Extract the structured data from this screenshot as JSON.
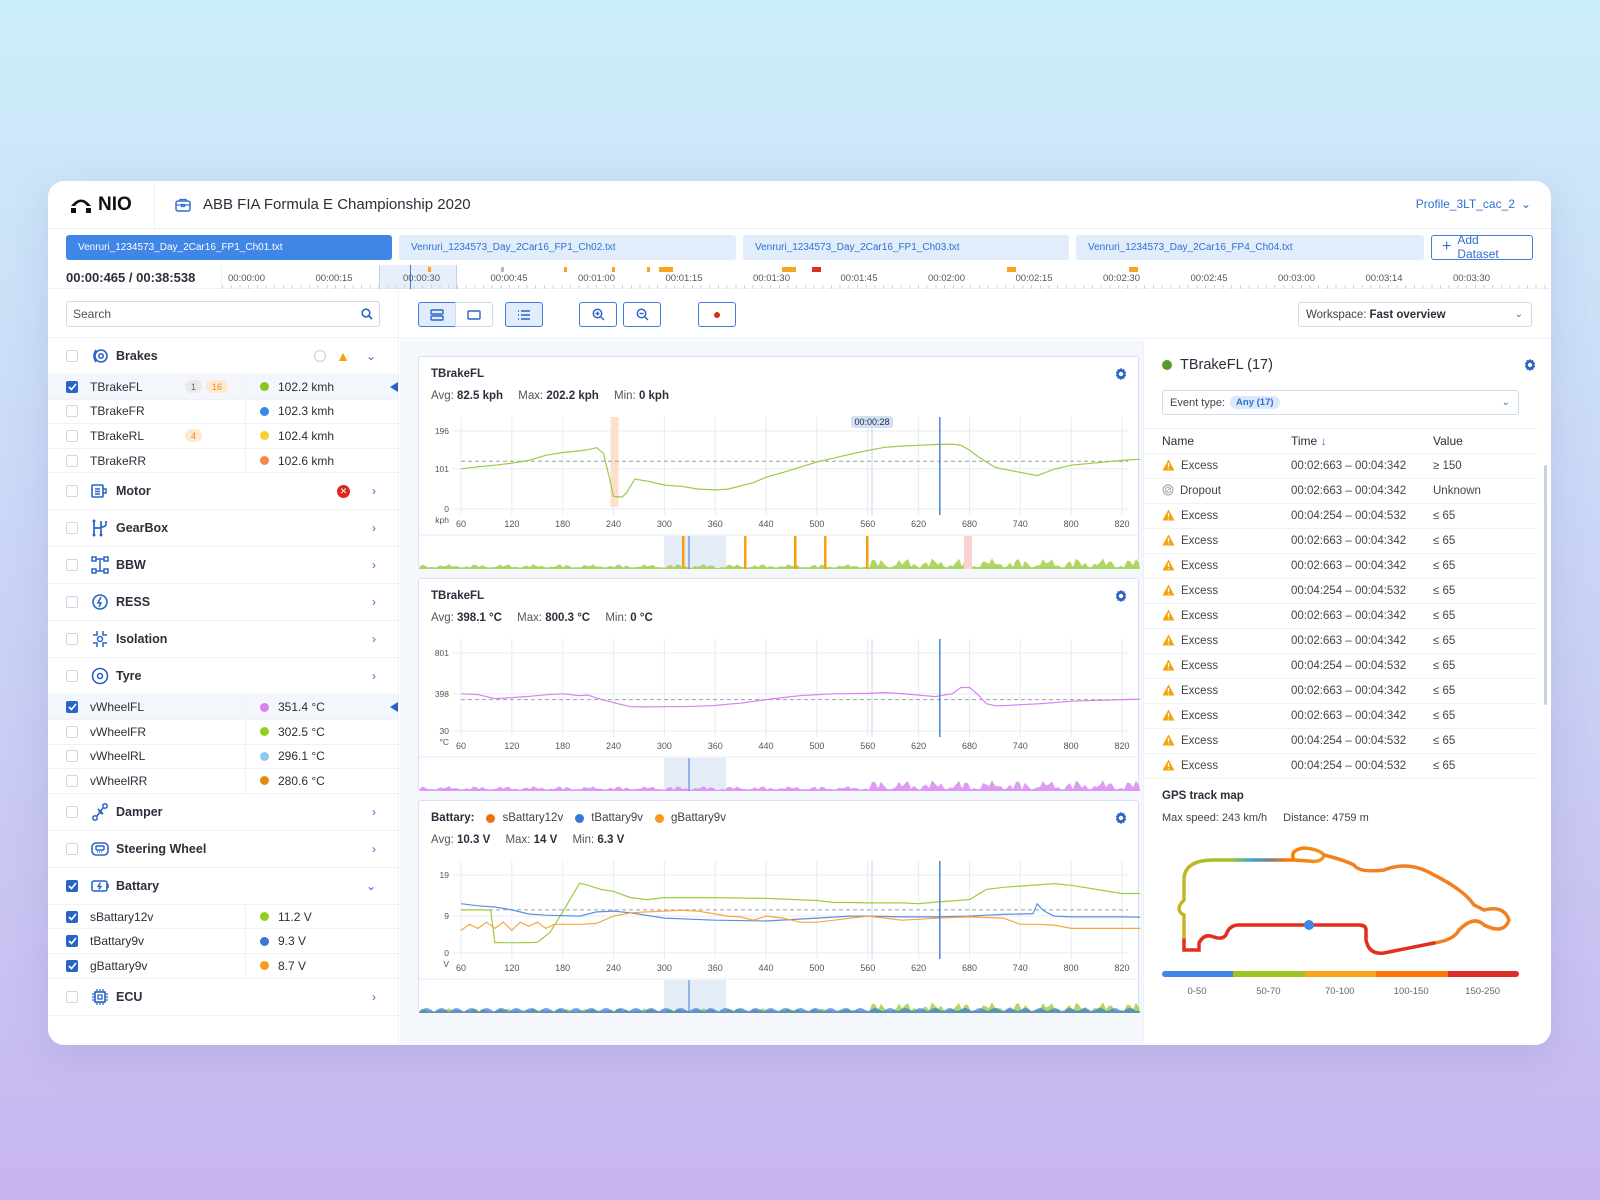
{
  "brand": {
    "name": "NIO"
  },
  "project": {
    "title": "ABB FIA Formula E Championship 2020"
  },
  "profile": {
    "name": "Profile_3LT_cac_2"
  },
  "datasets": {
    "tabs": [
      {
        "label": "Venruri_1234573_Day_2Car16_FP1_Ch01.txt",
        "active": true
      },
      {
        "label": "Venruri_1234573_Day_2Car16_FP1_Ch02.txt",
        "active": false
      },
      {
        "label": "Venruri_1234573_Day_2Car16_FP1_Ch03.txt",
        "active": false
      },
      {
        "label": "Venruri_1234573_Day_2Car16_FP4_Ch04.txt",
        "active": false
      }
    ],
    "add_label": "Add Dataset"
  },
  "timeline": {
    "current": "00:00:465 / 00:38:538",
    "labels": [
      "00:00:00",
      "00:00:15",
      "00:00:30",
      "00:00:45",
      "00:01:00",
      "00:01:15",
      "00:01:30",
      "00:01:45",
      "00:02:00",
      "00:02:15",
      "00:02:30",
      "00:02:45",
      "00:03:00",
      "00:03:14",
      "00:03:30"
    ],
    "markers_color": {
      "warning": "#f5a623",
      "error": "#d93025",
      "neutral": "#b8b8b8"
    }
  },
  "search": {
    "placeholder": "Search"
  },
  "workspace": {
    "label": "Workspace:",
    "value": "Fast overview"
  },
  "tree": {
    "brakes": {
      "name": "Brakes",
      "channels": [
        {
          "name": "TBrakeFL",
          "checked": true,
          "badges": [
            "1",
            "16"
          ],
          "value": "102.2 kmh",
          "color": "#8fc31f"
        },
        {
          "name": "TBrakeFR",
          "checked": false,
          "badges": [],
          "value": "102.3 kmh",
          "color": "#3a86e8"
        },
        {
          "name": "TBrakeRL",
          "checked": false,
          "badges": [
            "4"
          ],
          "value": "102.4 kmh",
          "color": "#f7cf2f"
        },
        {
          "name": "TBrakeRR",
          "checked": false,
          "badges": [],
          "value": "102.6 kmh",
          "color": "#f5894a"
        }
      ]
    },
    "motor": {
      "name": "Motor"
    },
    "gearbox": {
      "name": "GearBox"
    },
    "bbw": {
      "name": "BBW"
    },
    "ress": {
      "name": "RESS"
    },
    "isolation": {
      "name": "Isolation"
    },
    "tyre": {
      "name": "Tyre",
      "channels": [
        {
          "name": "vWheelFL",
          "checked": true,
          "value": "351.4 °C",
          "color": "#d783ef"
        },
        {
          "name": "vWheelFR",
          "checked": false,
          "value": "302.5 °C",
          "color": "#8fd11f"
        },
        {
          "name": "vWheelRL",
          "checked": false,
          "value": "296.1 °C",
          "color": "#8ccaf5"
        },
        {
          "name": "vWheelRR",
          "checked": false,
          "value": "280.6 °C",
          "color": "#e8890f"
        }
      ]
    },
    "damper": {
      "name": "Damper"
    },
    "steering": {
      "name": "Steering Wheel"
    },
    "battery": {
      "name": "Battary",
      "channels": [
        {
          "name": "sBattary12v",
          "checked": true,
          "value": "11.2 V",
          "color": "#8fd11f"
        },
        {
          "name": "tBattary9v",
          "checked": true,
          "value": "9.3 V",
          "color": "#3a76d8"
        },
        {
          "name": "gBattary9v",
          "checked": true,
          "value": "8.7 V",
          "color": "#f89a1c"
        }
      ]
    },
    "ecu": {
      "name": "ECU"
    }
  },
  "charts": [
    {
      "title": "TBrakeFL",
      "stats": {
        "avg_label": "Avg:",
        "avg": "82.5 kph",
        "max_label": "Max:",
        "max": "202.2 kph",
        "min_label": "Min:",
        "min": "0 kph"
      },
      "unit": "kph",
      "y_ticks": [
        "196",
        "101",
        "0"
      ],
      "cursor_label": "00:00:28"
    },
    {
      "title": "TBrakeFL",
      "stats": {
        "avg_label": "Avg:",
        "avg": "398.1 °C",
        "max_label": "Max:",
        "max": "800.3  °C",
        "min_label": "Min:",
        "min": "0 °C"
      },
      "unit": "°C",
      "y_ticks": [
        "801",
        "398",
        "30"
      ]
    },
    {
      "title": "Battary:",
      "legend": [
        "sBattary12v",
        "tBattary9v",
        "gBattary9v"
      ],
      "stats": {
        "avg_label": "Avg:",
        "avg": "10.3 V",
        "max_label": "Max:",
        "max": "14 V",
        "min_label": "Min:",
        "min": "6.3 V"
      },
      "unit": "V",
      "y_ticks": [
        "19",
        "9",
        "0"
      ]
    }
  ],
  "chart_data": [
    {
      "type": "line",
      "title": "TBrakeFL",
      "ylabel": "kph",
      "x_ticks": [
        60,
        120,
        180,
        240,
        300,
        360,
        440,
        500,
        560,
        620,
        680,
        740,
        800,
        820
      ],
      "ylim": [
        0,
        196
      ],
      "avg_line": 120,
      "series": [
        {
          "name": "TBrakeFL",
          "color": "#9acb4a",
          "x": [
            60,
            80,
            100,
            120,
            140,
            160,
            180,
            200,
            210,
            220,
            228,
            235,
            240,
            250,
            255,
            265,
            280,
            300,
            320,
            340,
            360,
            380,
            400,
            420,
            440,
            460,
            480,
            500,
            520,
            540,
            560,
            580,
            600,
            620,
            640,
            660,
            670,
            680,
            690,
            700,
            710,
            720,
            740,
            760,
            780,
            800,
            820,
            840,
            850,
            860,
            870,
            880
          ],
          "y": [
            101,
            106,
            110,
            115,
            122,
            135,
            142,
            146,
            149,
            154,
            140,
            80,
            32,
            30,
            40,
            75,
            70,
            60,
            57,
            50,
            48,
            50,
            58,
            66,
            80,
            92,
            105,
            118,
            128,
            138,
            147,
            155,
            158,
            160,
            162,
            163,
            160,
            148,
            132,
            118,
            105,
            100,
            92,
            84,
            100,
            110,
            122,
            130,
            110,
            104,
            100,
            96
          ]
        }
      ]
    },
    {
      "type": "line",
      "title": "TBrakeFL",
      "ylabel": "°C",
      "x_ticks": [
        60,
        120,
        180,
        240,
        300,
        360,
        440,
        500,
        560,
        620,
        680,
        740,
        800,
        820
      ],
      "ylim": [
        30,
        801
      ],
      "avg_line": 340,
      "series": [
        {
          "name": "vWheelFL",
          "color": "#d783ef",
          "x": [
            60,
            80,
            100,
            120,
            140,
            160,
            180,
            200,
            210,
            220,
            240,
            260,
            280,
            300,
            320,
            340,
            360,
            380,
            400,
            440,
            480,
            520,
            560,
            580,
            600,
            620,
            640,
            660,
            670,
            680,
            690,
            700,
            710,
            720,
            740,
            760,
            780,
            800,
            820,
            840,
            860,
            880
          ],
          "y": [
            398,
            390,
            350,
            360,
            372,
            388,
            398,
            380,
            385,
            355,
            310,
            270,
            268,
            270,
            270,
            275,
            282,
            295,
            305,
            340,
            380,
            398,
            402,
            410,
            400,
            385,
            370,
            400,
            460,
            460,
            390,
            300,
            280,
            280,
            290,
            298,
            310,
            325,
            340,
            350,
            358,
            360
          ]
        }
      ]
    },
    {
      "type": "line",
      "title": "Battary",
      "ylabel": "V",
      "x_ticks": [
        60,
        120,
        180,
        240,
        300,
        360,
        440,
        500,
        560,
        620,
        680,
        740,
        800,
        820
      ],
      "ylim": [
        0,
        19
      ],
      "avg_line": 10.5,
      "legend": [
        {
          "name": "sBattary12v",
          "color": "#e8740f"
        },
        {
          "name": "tBattary9v",
          "color": "#3a76d8"
        },
        {
          "name": "gBattary9v",
          "color": "#f89a1c"
        }
      ],
      "series": [
        {
          "name": "sBattary12v",
          "color": "#9ccd3d",
          "x": [
            60,
            85,
            95,
            100,
            120,
            140,
            150,
            165,
            180,
            200,
            210,
            225,
            240,
            260,
            280,
            300,
            360,
            440,
            500,
            520,
            540,
            560,
            600,
            620,
            640,
            680,
            700,
            720,
            740,
            760,
            780,
            800,
            820,
            860,
            880
          ],
          "y": [
            10.5,
            10.5,
            10.4,
            2.5,
            2.5,
            2.5,
            2.6,
            5,
            10,
            17,
            16.5,
            15.5,
            15,
            13.5,
            13,
            13.5,
            13.5,
            13.3,
            12.8,
            12.3,
            12.3,
            12.2,
            12.2,
            12,
            12.4,
            13,
            15.5,
            16,
            16.3,
            16.6,
            16.9,
            16.5,
            14.5,
            14.5,
            14.5
          ]
        },
        {
          "name": "tBattary9v",
          "color": "#5b8fe0",
          "x": [
            60,
            80,
            100,
            120,
            140,
            160,
            200,
            220,
            240,
            260,
            300,
            360,
            440,
            500,
            540,
            560,
            600,
            640,
            680,
            700,
            720,
            740,
            755,
            760,
            765,
            770,
            780,
            800,
            820,
            860,
            880
          ],
          "y": [
            12,
            11.5,
            11.2,
            10.5,
            9.5,
            9.2,
            9,
            10,
            10.2,
            9.8,
            8.5,
            8,
            7.8,
            8.5,
            9,
            9,
            8.8,
            8.8,
            9,
            9.2,
            9.4,
            9.5,
            9.6,
            12,
            10.8,
            10,
            9,
            8.8,
            8.8,
            8.5,
            8.5
          ]
        },
        {
          "name": "gBattary9v",
          "color": "#f9a63c",
          "x": [
            60,
            70,
            80,
            90,
            100,
            110,
            120,
            130,
            140,
            150,
            160,
            170,
            180,
            200,
            220,
            240,
            260,
            280,
            300,
            320,
            340,
            360,
            380,
            400,
            420,
            440,
            460,
            480,
            500,
            520,
            540,
            560,
            580,
            600,
            620,
            640,
            680,
            720,
            740,
            760,
            780,
            800,
            820,
            860,
            880
          ],
          "y": [
            5.5,
            7,
            6,
            7.5,
            6,
            7.5,
            5.5,
            7.5,
            6.5,
            7.5,
            6,
            7,
            7,
            7,
            7.2,
            9,
            9.8,
            10,
            10.2,
            10.4,
            10.2,
            9.5,
            9,
            8.8,
            8,
            9,
            8.5,
            7.5,
            7.5,
            8,
            8.5,
            9,
            8.5,
            8,
            8.2,
            8.5,
            8.8,
            8.5,
            7,
            7,
            6.8,
            6,
            6,
            6,
            6
          ]
        }
      ]
    }
  ],
  "events": {
    "title": "TBrakeFL (17)",
    "title_dot_color": "#5a9a2a",
    "filter_label": "Event type:",
    "filter_value": "Any (17)",
    "columns": [
      "Name",
      "Time",
      "Value"
    ],
    "rows": [
      {
        "icon": "warning",
        "name": "Excess",
        "time": "00:02:663 – 00:04:342",
        "value": "≥  150"
      },
      {
        "icon": "dropout",
        "name": "Dropout",
        "time": "00:02:663 – 00:04:342",
        "value": "Unknown"
      },
      {
        "icon": "warning",
        "name": "Excess",
        "time": "00:04:254 – 00:04:532",
        "value": "≤ 65"
      },
      {
        "icon": "warning",
        "name": "Excess",
        "time": "00:02:663 – 00:04:342",
        "value": "≤ 65"
      },
      {
        "icon": "warning",
        "name": "Excess",
        "time": "00:02:663 – 00:04:342",
        "value": "≤ 65"
      },
      {
        "icon": "warning",
        "name": "Excess",
        "time": "00:04:254 – 00:04:532",
        "value": "≤ 65"
      },
      {
        "icon": "warning",
        "name": "Excess",
        "time": "00:02:663 – 00:04:342",
        "value": "≤ 65"
      },
      {
        "icon": "warning",
        "name": "Excess",
        "time": "00:02:663 – 00:04:342",
        "value": "≤ 65"
      },
      {
        "icon": "warning",
        "name": "Excess",
        "time": "00:04:254 – 00:04:532",
        "value": "≤ 65"
      },
      {
        "icon": "warning",
        "name": "Excess",
        "time": "00:02:663 – 00:04:342",
        "value": "≤ 65"
      },
      {
        "icon": "warning",
        "name": "Excess",
        "time": "00:02:663 – 00:04:342",
        "value": "≤ 65"
      },
      {
        "icon": "warning",
        "name": "Excess",
        "time": "00:04:254 – 00:04:532",
        "value": "≤ 65"
      },
      {
        "icon": "warning",
        "name": "Excess",
        "time": "00:04:254 – 00:04:532",
        "value": "≤ 65"
      }
    ]
  },
  "gps": {
    "title": "GPS track map",
    "max_speed": "Max speed: 243 km/h",
    "distance": "Distance: 4759 m",
    "scale": [
      {
        "label": "0-50",
        "color": "#3f86e6"
      },
      {
        "label": "50-70",
        "color": "#9cc425"
      },
      {
        "label": "70-100",
        "color": "#fba31a"
      },
      {
        "label": "100-150",
        "color": "#ff7506"
      },
      {
        "label": "150-250",
        "color": "#dc2e26"
      }
    ]
  }
}
